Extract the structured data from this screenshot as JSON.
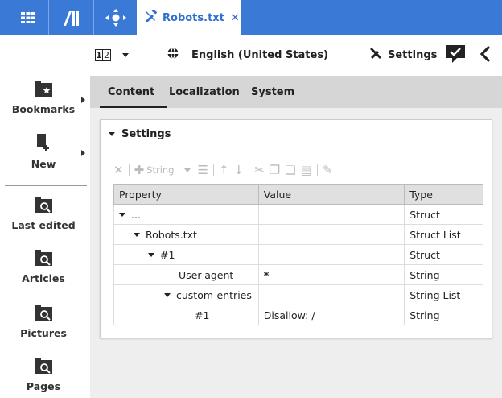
{
  "topbar": {
    "background": "#3a7ad6",
    "icons": [
      "grid-icon",
      "library-icon",
      "move-icon"
    ],
    "active_tab": {
      "icon": "wrench-icon",
      "label": "Robots.txt",
      "close_label": "✕"
    }
  },
  "subbar": {
    "page_indicator": "1|2",
    "language_icon": "globe-icon",
    "language": "English (United States)",
    "settings_icon": "tools-icon",
    "settings_label": "Settings"
  },
  "sidebar": {
    "items": [
      {
        "label": "Bookmarks",
        "icon": "bookmark-folder-icon"
      },
      {
        "label": "New",
        "icon": "new-document-icon"
      },
      {
        "label": "Last edited",
        "icon": "folder-search-icon"
      },
      {
        "label": "Articles",
        "icon": "folder-search-icon"
      },
      {
        "label": "Pictures",
        "icon": "folder-search-icon"
      },
      {
        "label": "Pages",
        "icon": "folder-search-icon"
      }
    ]
  },
  "tabs": [
    {
      "label": "Content",
      "active": true
    },
    {
      "label": "Localization",
      "active": false
    },
    {
      "label": "System",
      "active": false
    }
  ],
  "panel": {
    "title": "Settings",
    "toolbar": {
      "string_label": "String"
    },
    "columns": [
      "Property",
      "Value",
      "Type"
    ],
    "rows": [
      {
        "property": "...",
        "value": "",
        "type": "Struct"
      },
      {
        "property": "Robots.txt",
        "value": "",
        "type": "Struct List"
      },
      {
        "property": "#1",
        "value": "",
        "type": "Struct"
      },
      {
        "property": "User-agent",
        "value": "*",
        "type": "String"
      },
      {
        "property": "custom-entries",
        "value": "",
        "type": "String List"
      },
      {
        "property": "#1",
        "value": "Disallow: /",
        "type": "String"
      }
    ]
  }
}
